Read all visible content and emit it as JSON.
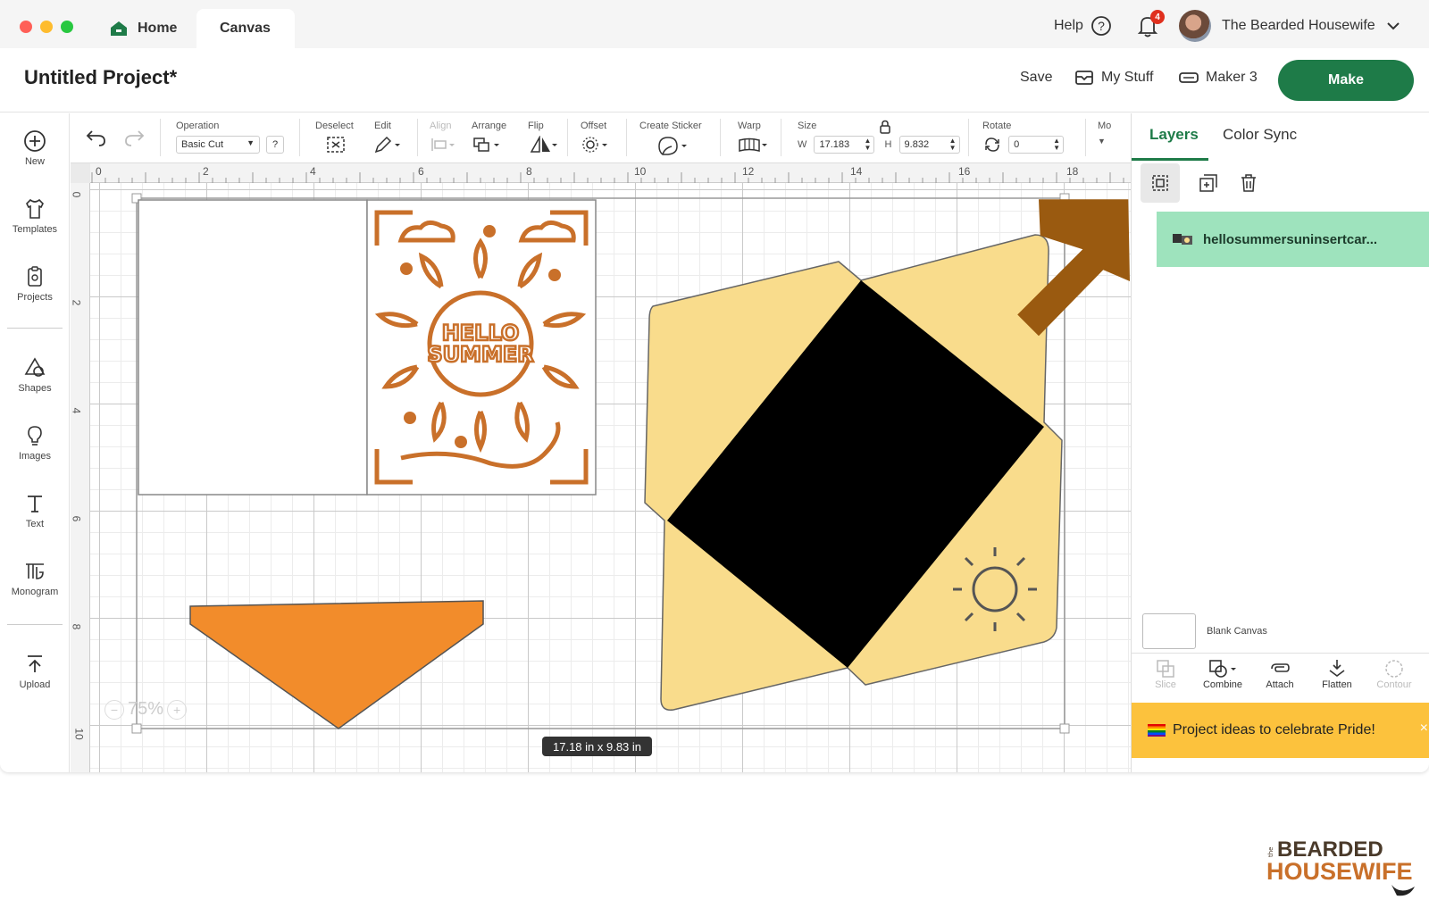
{
  "titlebar": {
    "tabs": [
      {
        "label": "Home"
      },
      {
        "label": "Canvas"
      }
    ],
    "help_label": "Help",
    "notification_count": "4",
    "user_name": "The Bearded Housewife"
  },
  "header": {
    "project_title": "Untitled Project*",
    "save_label": "Save",
    "my_stuff_label": "My Stuff",
    "machine_label": "Maker 3",
    "make_label": "Make"
  },
  "sidebar": {
    "items": [
      {
        "label": "New",
        "icon": "plus-circle-icon"
      },
      {
        "label": "Templates",
        "icon": "shirt-icon"
      },
      {
        "label": "Projects",
        "icon": "projects-icon"
      },
      {
        "label": "Shapes",
        "icon": "shapes-icon"
      },
      {
        "label": "Images",
        "icon": "lightbulb-icon"
      },
      {
        "label": "Text",
        "icon": "text-icon"
      },
      {
        "label": "Monogram",
        "icon": "monogram-icon"
      },
      {
        "label": "Upload",
        "icon": "upload-icon"
      }
    ]
  },
  "toolbar": {
    "operation_label": "Operation",
    "operation_value": "Basic Cut",
    "help_q": "?",
    "deselect_label": "Deselect",
    "edit_label": "Edit",
    "align_label": "Align",
    "arrange_label": "Arrange",
    "flip_label": "Flip",
    "offset_label": "Offset",
    "create_sticker_label": "Create Sticker",
    "warp_label": "Warp",
    "size_label": "Size",
    "w_label": "W",
    "w_value": "17.183",
    "h_label": "H",
    "h_value": "9.832",
    "rotate_label": "Rotate",
    "rotate_value": "0",
    "more_label": "Mo"
  },
  "canvas": {
    "ruler_h": [
      "0",
      "2",
      "4",
      "6",
      "8",
      "10",
      "12",
      "14",
      "16",
      "18"
    ],
    "ruler_v": [
      "0",
      "2",
      "4",
      "6",
      "8",
      "10"
    ],
    "size_readout": "17.18  in x 9.83  in",
    "zoom": "75%",
    "card_text_line1": "HELLO",
    "card_text_line2": "SUMMER"
  },
  "right_panel": {
    "tabs": [
      {
        "label": "Layers"
      },
      {
        "label": "Color Sync"
      }
    ],
    "layer_name": "hellosummersuninsertcar...",
    "blank_canvas_label": "Blank Canvas",
    "bottom_tools": [
      {
        "label": "Slice"
      },
      {
        "label": "Combine"
      },
      {
        "label": "Attach"
      },
      {
        "label": "Flatten"
      },
      {
        "label": "Contour"
      }
    ],
    "banner": "Project ideas to celebrate Pride!"
  },
  "logo": {
    "small": "the",
    "line1": "BEARDED",
    "line2": "HOUSEWIFE"
  },
  "colors": {
    "accent": "#1e7b48",
    "layer_highlight": "#9ee3bd",
    "banner": "#fcc23d",
    "arrow": "#9a5a10",
    "envelope": "#f9dc8c",
    "orange_shape": "#f28c2b",
    "card_orange": "#c9702a"
  }
}
